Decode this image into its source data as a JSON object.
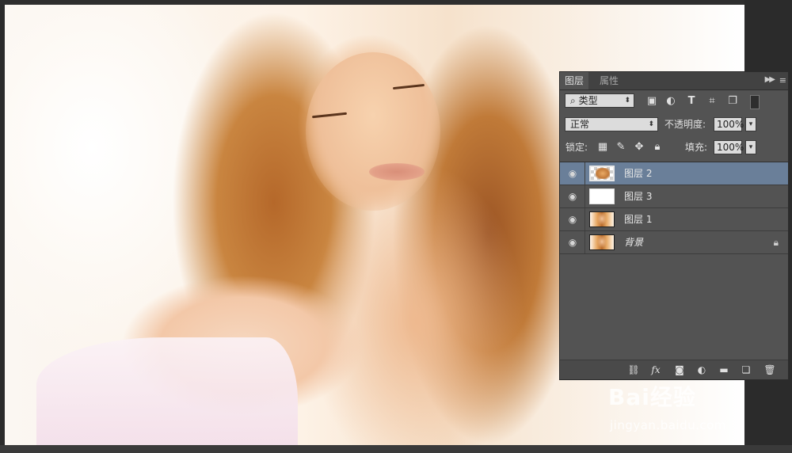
{
  "layers_panel": {
    "tabs": [
      {
        "label": "图层",
        "active": true
      },
      {
        "label": "属性",
        "active": false
      }
    ],
    "filter": {
      "kind_label": "类型"
    },
    "blend_mode": "正常",
    "opacity_label": "不透明度:",
    "opacity_value": "100%",
    "lock_label": "锁定:",
    "fill_label": "填充:",
    "fill_value": "100%",
    "layers": [
      {
        "name": "图层 2",
        "selected": true,
        "thumb": "checker",
        "visible": true
      },
      {
        "name": "图层 3",
        "selected": false,
        "thumb": "white",
        "visible": true
      },
      {
        "name": "图层 1",
        "selected": false,
        "thumb": "portrait",
        "visible": true
      },
      {
        "name": "背景",
        "selected": false,
        "thumb": "portrait",
        "visible": true,
        "locked": true
      }
    ],
    "colors": {
      "panel_bg": "#535353",
      "selected_row": "#6a7f99"
    }
  },
  "watermark": {
    "brand": "Bai经验",
    "url": "jingyan.baidu.com"
  }
}
